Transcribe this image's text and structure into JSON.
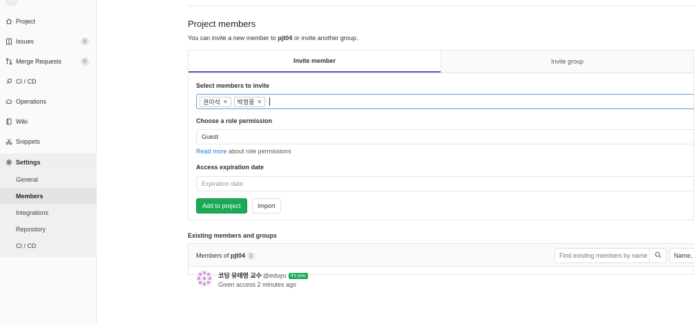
{
  "sidebar": {
    "project_name": "pjt04",
    "items": [
      {
        "label": "Project",
        "icon": "home-icon"
      },
      {
        "label": "Issues",
        "icon": "issues-icon",
        "badge": "0"
      },
      {
        "label": "Merge Requests",
        "icon": "merge-request-icon",
        "badge": "0"
      },
      {
        "label": "CI / CD",
        "icon": "rocket-icon"
      },
      {
        "label": "Operations",
        "icon": "cloud-gear-icon"
      },
      {
        "label": "Wiki",
        "icon": "book-icon"
      },
      {
        "label": "Snippets",
        "icon": "scissors-icon"
      },
      {
        "label": "Settings",
        "icon": "gear-icon"
      }
    ],
    "settings_sub": [
      "General",
      "Members",
      "Integrations",
      "Repository",
      "CI / CD"
    ]
  },
  "main": {
    "title": "Project members",
    "desc_prefix": "You can invite a new member to ",
    "desc_project": "pjt04",
    "desc_suffix": " or invite another group.",
    "tabs": [
      "Invite member",
      "Invite group"
    ],
    "form": {
      "select_label": "Select members to invite",
      "tokens": [
        "권이석",
        "박정웅"
      ],
      "role_label": "Choose a role permission",
      "role_value": "Guest",
      "read_more": "Read more",
      "read_more_suffix": " about role permissions",
      "expiration_label": "Access expiration date",
      "expiration_placeholder": "Expiration date",
      "add_button": "Add to project",
      "import_button": "Import"
    },
    "existing": {
      "title": "Existing members and groups",
      "members_of_prefix": "Members of ",
      "project": "pjt04",
      "count": "1",
      "search_placeholder": "Find existing members by name",
      "sort_label": "Name, ",
      "member": {
        "name": "코딩 유태영 교수",
        "username": "@eduyu",
        "badge": "It's you",
        "access": "Given access 2 minutes ago"
      }
    }
  },
  "colors": {
    "accent": "#6b4fbb",
    "success": "#1aaa55",
    "link": "#1f78d1"
  }
}
